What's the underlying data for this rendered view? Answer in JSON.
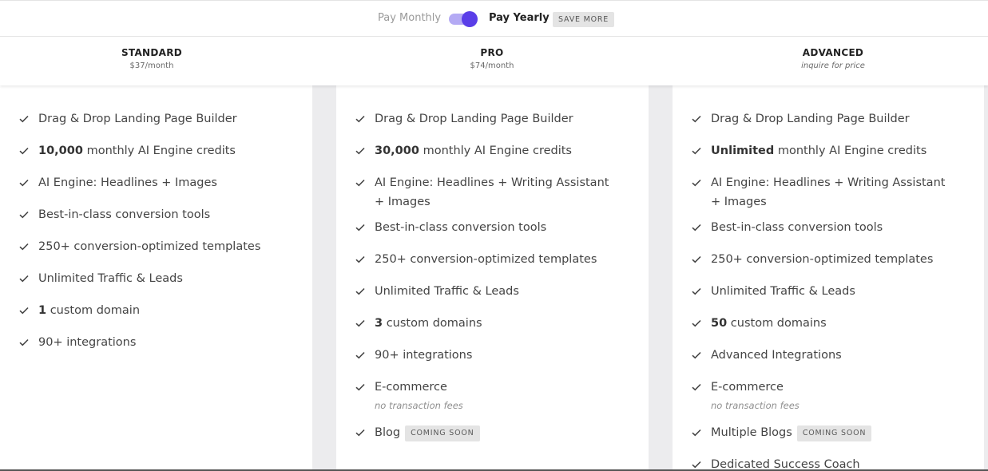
{
  "billing_toggle": {
    "monthly_label": "Pay Monthly",
    "yearly_label": "Pay Yearly",
    "save_badge": "SAVE MORE",
    "selected": "yearly"
  },
  "plans": [
    {
      "name": "STANDARD",
      "price": "$37/month",
      "features": {
        "f0": "Drag & Drop Landing Page Builder",
        "f1_bold": "10,000",
        "f1_rest": " monthly AI Engine credits",
        "f2": "AI Engine: Headlines + Images",
        "f3": "Best-in-class conversion tools",
        "f4": "250+ conversion-optimized templates",
        "f5": "Unlimited Traffic & Leads",
        "f6_bold": "1",
        "f6_rest": " custom domain",
        "f7": "90+ integrations"
      }
    },
    {
      "name": "PRO",
      "price": "$74/month",
      "features": {
        "f0": "Drag & Drop Landing Page Builder",
        "f1_bold": "30,000",
        "f1_rest": " monthly AI Engine credits",
        "f2": "AI Engine: Headlines + Writing Assistant + Images",
        "f3": "Best-in-class conversion tools",
        "f4": "250+ conversion-optimized templates",
        "f5": "Unlimited Traffic & Leads",
        "f6_bold": "3",
        "f6_rest": " custom domains",
        "f7": "90+ integrations",
        "f8": "E-commerce",
        "f8_sub": "no transaction fees",
        "f9": "Blog",
        "f9_badge": "COMING SOON"
      }
    },
    {
      "name": "ADVANCED",
      "price": "inquire for price",
      "features": {
        "f0": "Drag & Drop Landing Page Builder",
        "f1_bold": "Unlimited",
        "f1_rest": " monthly AI Engine credits",
        "f2": "AI Engine: Headlines + Writing Assistant + Images",
        "f3": "Best-in-class conversion tools",
        "f4": "250+ conversion-optimized templates",
        "f5": "Unlimited Traffic & Leads",
        "f6_bold": "50",
        "f6_rest": " custom domains",
        "f7": "Advanced Integrations",
        "f8": "E-commerce",
        "f8_sub": "no transaction fees",
        "f9": "Multiple Blogs",
        "f9_badge": "COMING SOON",
        "f10": "Dedicated Success Coach"
      }
    }
  ],
  "colors": {
    "accent": "#5a3ee8",
    "accent_light": "#b4aaf4",
    "page_bg": "#ececee"
  },
  "icons": {
    "check": "check-icon"
  }
}
